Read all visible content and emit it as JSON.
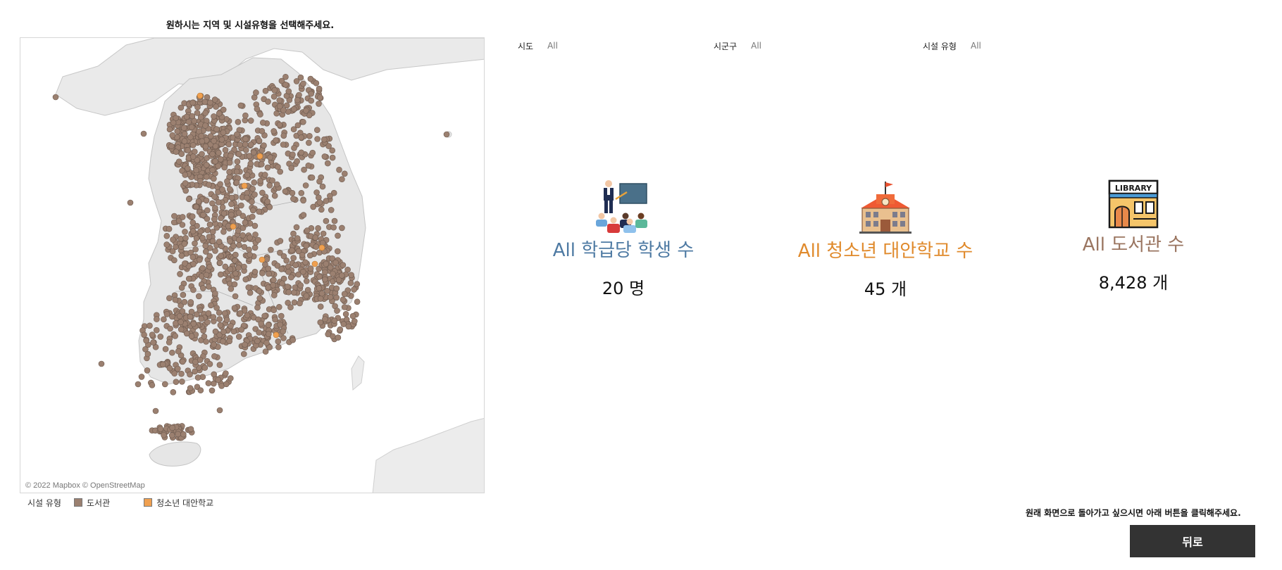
{
  "map": {
    "title": "원하시는 지역 및 시설유형을 선택해주세요.",
    "credit": "© 2022 Mapbox © OpenStreetMap",
    "dot_colors": {
      "library": "#9b8070",
      "alternative_school": "#f0a050"
    }
  },
  "legend": {
    "title": "시설 유형",
    "items": [
      {
        "label": "도서관",
        "color": "#9b8070"
      },
      {
        "label": "청소년 대안학교",
        "color": "#f0a050"
      }
    ]
  },
  "filters": [
    {
      "label": "시도",
      "value": "All"
    },
    {
      "label": "시군구",
      "value": "All"
    },
    {
      "label": "시설 유형",
      "value": "All"
    }
  ],
  "kpis": [
    {
      "icon": "teacher-classroom-icon",
      "title": "All 학급당 학생 수",
      "value": "20 명",
      "color": "#4e7aa3"
    },
    {
      "icon": "school-building-icon",
      "title": "All 청소년 대안학교 수",
      "value": "45 개",
      "color": "#e08a2c"
    },
    {
      "icon": "library-building-icon",
      "title": "All 도서관 수",
      "value": "8,428 개",
      "color": "#9a7560"
    }
  ],
  "back": {
    "note": "원래 화면으로 돌아가고 싶으시면 아래 버튼을 클릭해주세요.",
    "button_label": "뒤로"
  }
}
